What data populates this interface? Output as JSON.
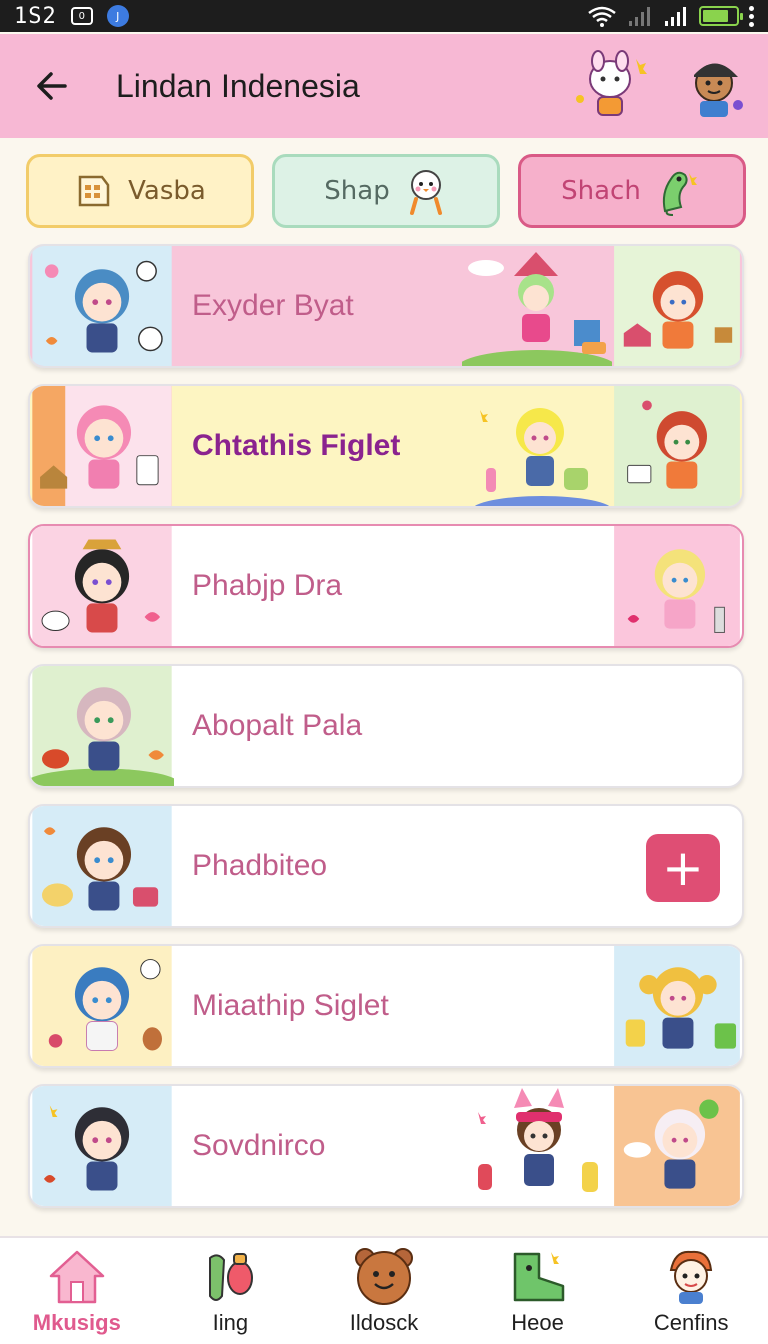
{
  "status_bar": {
    "time": "1S2",
    "icon_box_text": "0",
    "icon_dot_text": "J"
  },
  "header": {
    "title": "Lindan Indenesia"
  },
  "chips": [
    {
      "label": "Vasba",
      "icon": "calendar-icon"
    },
    {
      "label": "Shap",
      "icon": "chick-icon"
    },
    {
      "label": "Shach",
      "icon": "dino-icon"
    }
  ],
  "list": [
    {
      "label": "Exyder Byat"
    },
    {
      "label": "Chtathis Figlet"
    },
    {
      "label": "Phabjp Dra"
    },
    {
      "label": "Abopalt Pala"
    },
    {
      "label": "Phadbiteo",
      "action": "+"
    },
    {
      "label": "Miaathip Siglet"
    },
    {
      "label": "Sovdnirco"
    }
  ],
  "bottom_nav": [
    {
      "label": "Mkusigs",
      "icon": "house-icon",
      "active": true
    },
    {
      "label": "Iing",
      "icon": "bottles-icon"
    },
    {
      "label": "Ildosck",
      "icon": "bear-icon"
    },
    {
      "label": "Heoe",
      "icon": "boot-icon"
    },
    {
      "label": "Cenfins",
      "icon": "mascot-icon"
    }
  ],
  "colors": {
    "header_bg": "#f7b8d4",
    "accent": "#df4e74",
    "row_label": "#c05d8a",
    "battery": "#8ad34d"
  }
}
